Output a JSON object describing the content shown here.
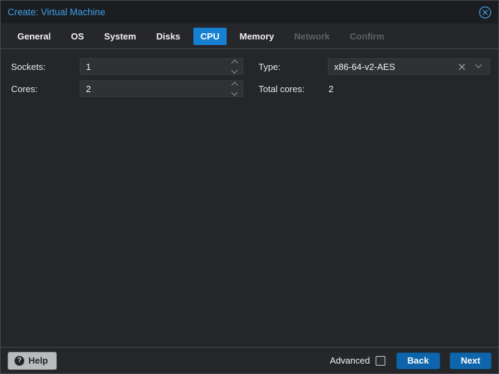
{
  "window": {
    "title": "Create: Virtual Machine"
  },
  "tabs": [
    {
      "label": "General",
      "state": "normal"
    },
    {
      "label": "OS",
      "state": "normal"
    },
    {
      "label": "System",
      "state": "normal"
    },
    {
      "label": "Disks",
      "state": "normal"
    },
    {
      "label": "CPU",
      "state": "active"
    },
    {
      "label": "Memory",
      "state": "normal"
    },
    {
      "label": "Network",
      "state": "disabled"
    },
    {
      "label": "Confirm",
      "state": "disabled"
    }
  ],
  "form": {
    "sockets": {
      "label": "Sockets:",
      "value": "1"
    },
    "cores": {
      "label": "Cores:",
      "value": "2"
    },
    "type": {
      "label": "Type:",
      "value": "x86-64-v2-AES"
    },
    "total_cores": {
      "label": "Total cores:",
      "value": "2"
    }
  },
  "footer": {
    "help": "Help",
    "advanced": "Advanced",
    "advanced_checked": false,
    "back": "Back",
    "next": "Next"
  },
  "icons": {
    "close": "circle-x-icon",
    "help": "question-circle-icon",
    "clear": "x-icon",
    "dropdown": "chevron-down-icon",
    "spinner_up": "chevron-up-icon",
    "spinner_down": "chevron-down-icon"
  },
  "colors": {
    "title_text": "#3ba3e9",
    "active_tab_bg": "#1780d2",
    "button_blue": "#0e65ab",
    "field_bg": "#2f3134",
    "panel_bg": "#252629",
    "titlebar_bg": "#1c1d21",
    "disabled_tab_text": "#5d6165"
  }
}
